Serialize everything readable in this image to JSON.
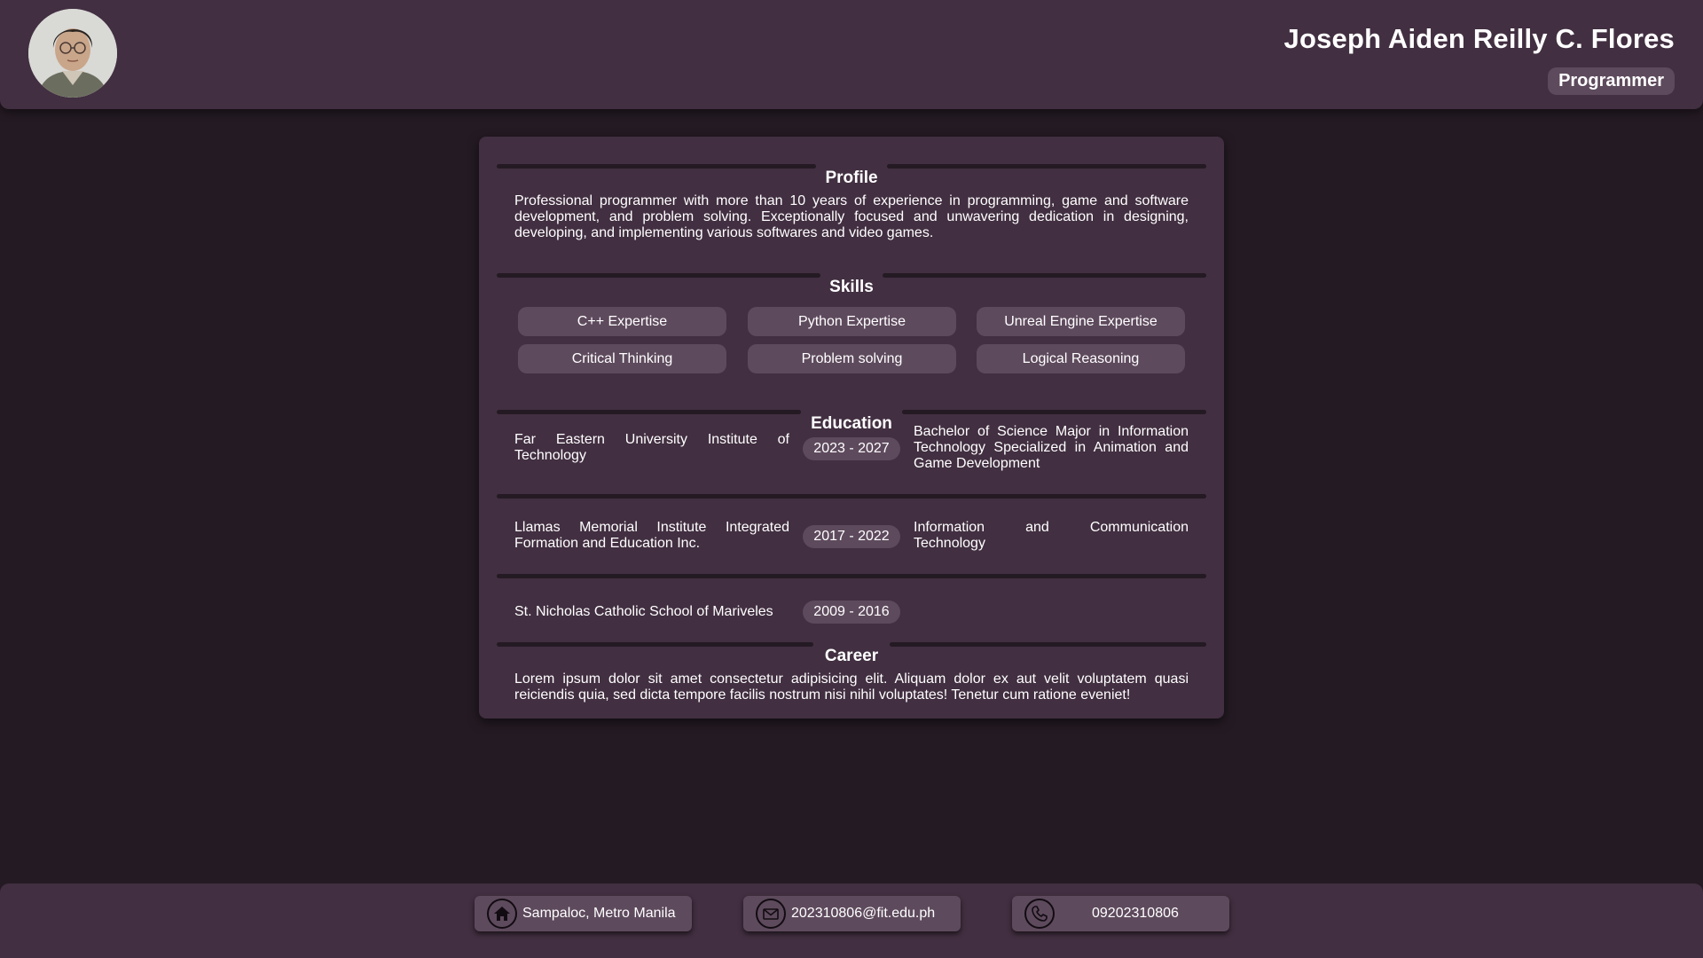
{
  "header": {
    "name": "Joseph Aiden Reilly C. Flores",
    "role": "Programmer"
  },
  "profile": {
    "title": "Profile",
    "text": "Professional programmer with more than 10 years of experience in programming, game and software development, and problem solving. Exceptionally focused and unwavering dedication in designing, developing, and implementing various softwares and video games."
  },
  "skills": {
    "title": "Skills",
    "items": [
      "C++ Expertise",
      "Python Expertise",
      "Unreal Engine Expertise",
      "Critical Thinking",
      "Problem solving",
      "Logical Reasoning"
    ]
  },
  "education": {
    "title": "Education",
    "entries": [
      {
        "school": "Far Eastern University Institute of Technology",
        "years": "2023 - 2027",
        "degree": "Bachelor of Science Major in Information Technology Specialized in Animation and Game Development"
      },
      {
        "school": "Llamas Memorial Institute Integrated Formation and Education Inc.",
        "years": "2017 - 2022",
        "degree": "Information and Communication Technology"
      },
      {
        "school": "St. Nicholas Catholic School of Mariveles",
        "years": "2009 - 2016",
        "degree": ""
      }
    ]
  },
  "career": {
    "title": "Career",
    "text": "Lorem ipsum dolor sit amet consectetur adipisicing elit. Aliquam dolor ex aut velit voluptatem quasi reiciendis quia, sed dicta tempore facilis nostrum nisi nihil voluptates! Tenetur cum ratione eveniet!"
  },
  "footer": {
    "address": "Sampaloc, Metro Manila",
    "email": "202310806@fit.edu.ph",
    "phone": "09202310806"
  },
  "icons": {
    "address": "home-icon",
    "email": "mail-icon",
    "phone": "phone-icon"
  },
  "colors": {
    "background": "#241a23",
    "panel": "#422f41",
    "chip": "#5e4a5d",
    "text": "#ffffff"
  }
}
